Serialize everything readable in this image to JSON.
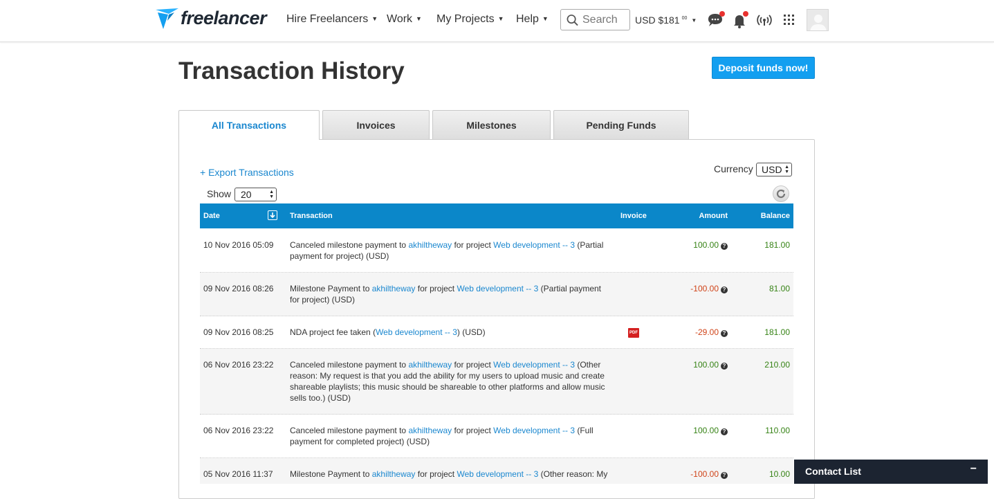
{
  "header": {
    "logo_text": "freelancer",
    "nav": [
      {
        "label": "Hire Freelancers"
      },
      {
        "label": "Work"
      },
      {
        "label": "My Projects"
      },
      {
        "label": "Help"
      }
    ],
    "search_placeholder": "Search",
    "balance": {
      "label": "USD $181",
      "cents": "00"
    },
    "icons": [
      "messages-icon",
      "notifications-icon",
      "broadcast-icon",
      "apps-grid-icon"
    ],
    "accent_color": "#139ff0",
    "alert_dot_color": "#e8312f"
  },
  "page": {
    "title": "Transaction History",
    "deposit_label": "Deposit funds now!"
  },
  "tabs": [
    {
      "label": "All Transactions",
      "active": true
    },
    {
      "label": "Invoices",
      "active": false
    },
    {
      "label": "Milestones",
      "active": false
    },
    {
      "label": "Pending Funds",
      "active": false
    }
  ],
  "controls": {
    "export_label": "+ Export Transactions",
    "currency_label": "Currency",
    "currency_value": "USD",
    "show_label": "Show",
    "show_value": "20"
  },
  "table": {
    "headers": {
      "date": "Date",
      "transaction": "Transaction",
      "invoice": "Invoice",
      "amount": "Amount",
      "balance": "Balance"
    },
    "rows": [
      {
        "date": "10 Nov 2016 05:09",
        "tx_prefix": "Canceled milestone payment to ",
        "user": "akhiltheway",
        "tx_mid": " for project ",
        "project": "Web development -- 3",
        "tx_suffix": " (Partial payment for project) (USD)",
        "invoice": "",
        "amount": "100.00",
        "amount_sign": "positive",
        "balance": "181.00"
      },
      {
        "date": "09 Nov 2016 08:26",
        "tx_prefix": "Milestone Payment to ",
        "user": "akhiltheway",
        "tx_mid": " for project ",
        "project": "Web development -- 3",
        "tx_suffix": " (Partial payment for project) (USD)",
        "invoice": "",
        "amount": "-100.00",
        "amount_sign": "negative",
        "balance": "81.00"
      },
      {
        "date": "09 Nov 2016 08:25",
        "tx_prefix": "NDA project fee taken (",
        "user": "",
        "tx_mid": "",
        "project": "Web development -- 3",
        "tx_suffix": ") (USD)",
        "invoice": "PDF",
        "amount": "-29.00",
        "amount_sign": "negative",
        "balance": "181.00"
      },
      {
        "date": "06 Nov 2016 23:22",
        "tx_prefix": "Canceled milestone payment to ",
        "user": "akhiltheway",
        "tx_mid": " for project ",
        "project": "Web development -- 3",
        "tx_suffix": " (Other reason: My request is that you add the ability for my users to upload music and create shareable playlists; this music should be shareable to other platforms and allow music sells too.) (USD)",
        "invoice": "",
        "amount": "100.00",
        "amount_sign": "positive",
        "balance": "210.00"
      },
      {
        "date": "06 Nov 2016 23:22",
        "tx_prefix": "Canceled milestone payment to ",
        "user": "akhiltheway",
        "tx_mid": " for project ",
        "project": "Web development -- 3",
        "tx_suffix": " (Full payment for completed project) (USD)",
        "invoice": "",
        "amount": "100.00",
        "amount_sign": "positive",
        "balance": "110.00"
      },
      {
        "date": "05 Nov 2016 11:37",
        "tx_prefix": "Milestone Payment to ",
        "user": "akhiltheway",
        "tx_mid": " for project ",
        "project": "Web development -- 3",
        "tx_suffix": " (Other reason: My",
        "invoice": "",
        "amount": "-100.00",
        "amount_sign": "negative",
        "balance": "10.00"
      }
    ]
  },
  "contact_list": {
    "label": "Contact List",
    "toggle": "−"
  }
}
